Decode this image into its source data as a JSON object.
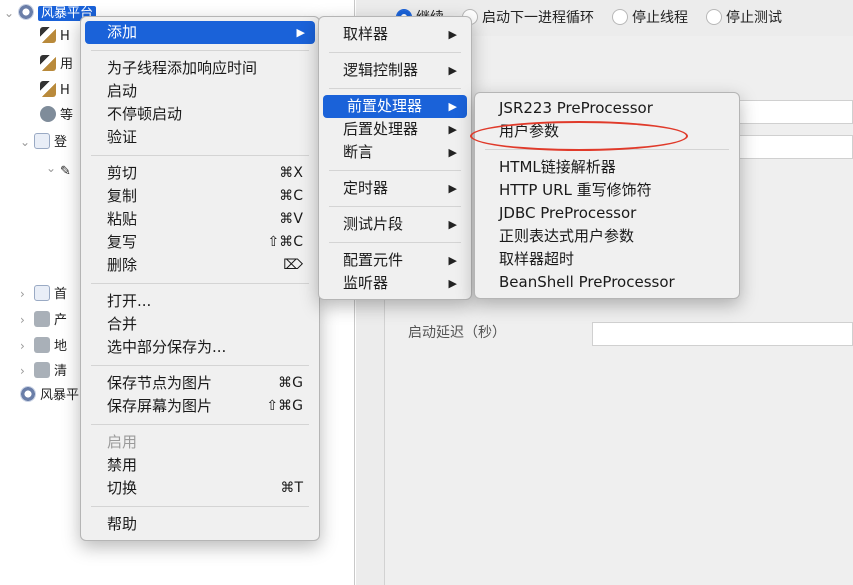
{
  "tree": {
    "root_label": "风暴平台",
    "second_root_label": "风暴平台",
    "nodes": [
      {
        "label": "H"
      },
      {
        "label": "用"
      },
      {
        "label": "H"
      },
      {
        "label": "等"
      },
      {
        "label": "登"
      },
      {
        "label": "首"
      },
      {
        "label": "产"
      },
      {
        "label": "地"
      },
      {
        "label": "清"
      }
    ]
  },
  "right_panel": {
    "radios": [
      {
        "label": "继续",
        "selected": true
      },
      {
        "label": "启动下一进程循环",
        "selected": false
      },
      {
        "label": "停止线程",
        "selected": false
      },
      {
        "label": "停止测试",
        "selected": false
      }
    ],
    "delay_label": "启动延迟（秒）"
  },
  "menu_main": {
    "add": "添加",
    "add_response_time": "为子线程添加响应时间",
    "start": "启动",
    "start_no_pause": "不停顿启动",
    "validate": "验证",
    "cut": "剪切",
    "cut_sc": "⌘X",
    "copy": "复制",
    "copy_sc": "⌘C",
    "paste": "粘贴",
    "paste_sc": "⌘V",
    "duplicate": "复写",
    "duplicate_sc": "⇧⌘C",
    "delete": "删除",
    "delete_sc": "⌦",
    "open": "打开...",
    "merge": "合并",
    "save_selection": "选中部分保存为...",
    "save_node_image": "保存节点为图片",
    "save_node_image_sc": "⌘G",
    "save_screen_image": "保存屏幕为图片",
    "save_screen_image_sc": "⇧⌘G",
    "enable": "启用",
    "disable": "禁用",
    "toggle": "切换",
    "toggle_sc": "⌘T",
    "help": "帮助"
  },
  "menu_add": {
    "items": [
      {
        "label": "取样器"
      },
      {
        "label": "逻辑控制器"
      },
      {
        "label": "前置处理器"
      },
      {
        "label": "后置处理器"
      },
      {
        "label": "断言"
      },
      {
        "label": "定时器"
      },
      {
        "label": "测试片段"
      },
      {
        "label": "配置元件"
      },
      {
        "label": "监听器"
      }
    ]
  },
  "menu_preprocessor": {
    "jsr223": "JSR223 PreProcessor",
    "user_params": "用户参数",
    "html_link_parser": "HTML链接解析器",
    "http_url_rewrite": "HTTP URL 重写修饰符",
    "jdbc": "JDBC PreProcessor",
    "regex_user_params": "正则表达式用户参数",
    "sample_timeout": "取样器超时",
    "beanshell": "BeanShell PreProcessor"
  },
  "colors": {
    "selection_blue": "#1a62d9",
    "annotation_red": "#e03a2a",
    "menu_bg": "#f0f0f0"
  }
}
